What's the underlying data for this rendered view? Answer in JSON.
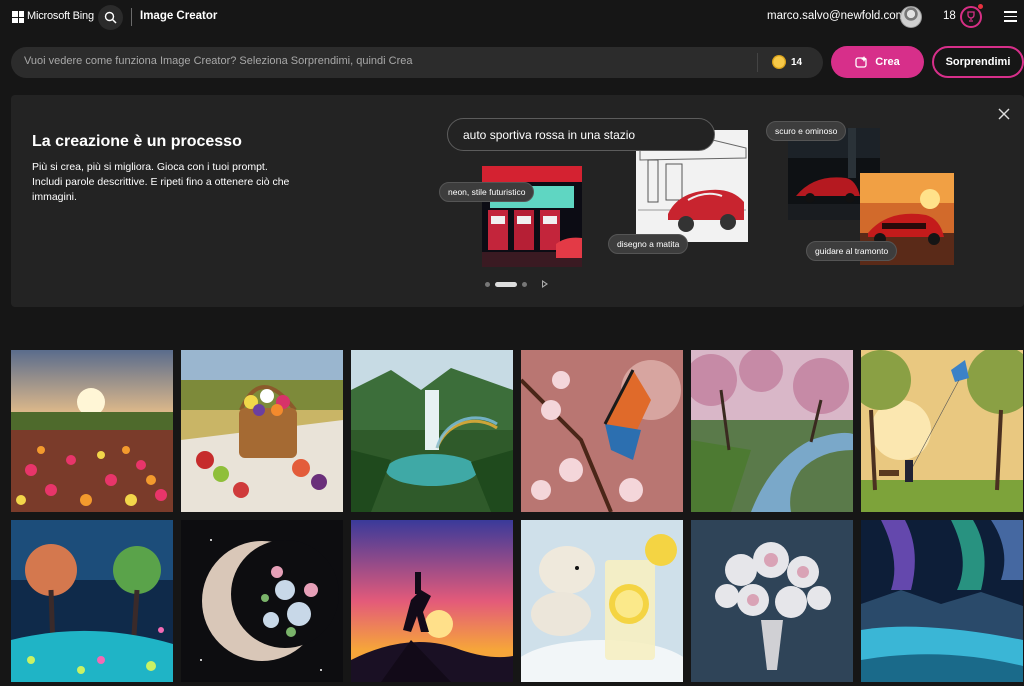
{
  "header": {
    "brand": "Microsoft Bing",
    "product": "Image Creator",
    "user_email": "marco.salvo@newfold.com",
    "coin_count": "18",
    "accent_color": "#d72f8a"
  },
  "prompt": {
    "placeholder": "Vuoi vedere come funziona Image Creator? Seleziona Sorprendimi, quindi Crea",
    "boost_count": "14",
    "create_label": "Crea",
    "surprise_label": "Sorprendimi"
  },
  "info_panel": {
    "title": "La creazione è un processo",
    "body": "Più si crea, più si migliora. Gioca con i tuoi prompt. Includi parole descrittive. E ripeti fino a ottenere ciò che immagini.",
    "demo_prompt": "auto sportiva rossa in una stazio",
    "chips": {
      "neon": "neon, stile futuristico",
      "pencil": "disegno a matita",
      "dark": "scuro e ominoso",
      "sunset": "guidare al tramonto"
    }
  },
  "gallery": [
    {
      "subject": "tulip field at sunset"
    },
    {
      "subject": "picnic basket with flowers"
    },
    {
      "subject": "jungle waterfall with rainbow"
    },
    {
      "subject": "butterfly on cherry blossom"
    },
    {
      "subject": "cherry blossom river path"
    },
    {
      "subject": "park with kite at sunset"
    },
    {
      "subject": "fantasy neon forest"
    },
    {
      "subject": "crescent moon with flowers"
    },
    {
      "subject": "horse rider silhouette"
    },
    {
      "subject": "polar bears and lemonade"
    },
    {
      "subject": "white flower bouquet"
    },
    {
      "subject": "northern lights landscape"
    }
  ]
}
